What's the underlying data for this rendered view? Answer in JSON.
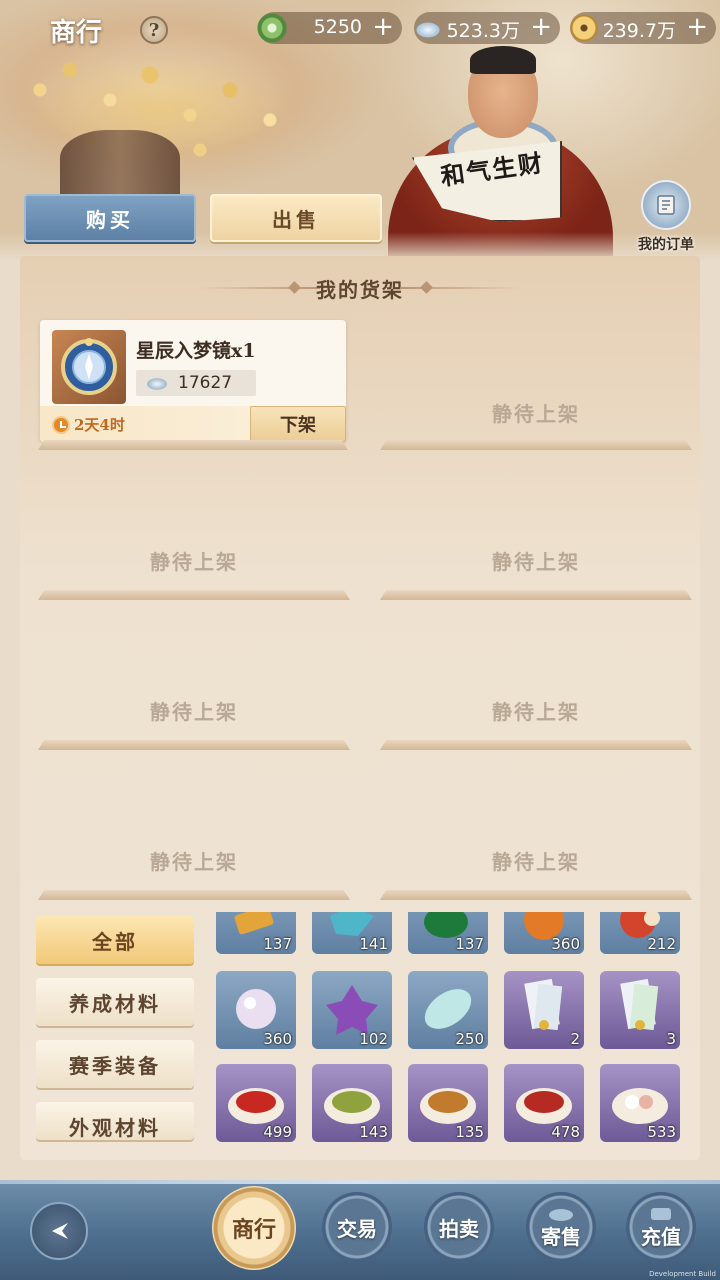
{
  "header": {
    "title": "商行",
    "help_label": "?",
    "currencies": [
      {
        "icon": "jade-coin-icon",
        "value": "5250",
        "add": "+"
      },
      {
        "icon": "silver-ingot-icon",
        "value": "523.3万",
        "add": "+"
      },
      {
        "icon": "copper-coin-icon",
        "value": "239.7万",
        "add": "+"
      }
    ],
    "fan_text": "和气生财"
  },
  "tabs": {
    "buy": "购买",
    "sell": "出售"
  },
  "orders": {
    "label": "我的订单",
    "icon": "scroll-icon"
  },
  "shelf": {
    "title": "我的货架",
    "listing": {
      "name": "星辰入梦镜x1",
      "price": "17627",
      "price_icon": "silver-ingot-icon",
      "time_left": "2天4时",
      "delist_label": "下架"
    },
    "empty_label": "静待上架"
  },
  "categories": [
    "全部",
    "养成材料",
    "赛季装备",
    "外观材料"
  ],
  "inventory": {
    "row1": [
      "137",
      "141",
      "137",
      "360",
      "212"
    ],
    "row2": [
      "360",
      "102",
      "250",
      "2",
      "3"
    ],
    "row3": [
      "499",
      "143",
      "135",
      "478",
      "533"
    ]
  },
  "nav": {
    "shop": "商行",
    "trade": "交易",
    "auction": "拍卖",
    "consign": "寄售",
    "recharge": "充值"
  },
  "footer_note": "Development Build",
  "colors": {
    "buy_tab": "#6f93b6",
    "sell_tab": "#f4dcaa",
    "accent_gold": "#f1c878",
    "bottom_bar": "#4f6f8f",
    "timer_orange": "#c2681f"
  }
}
